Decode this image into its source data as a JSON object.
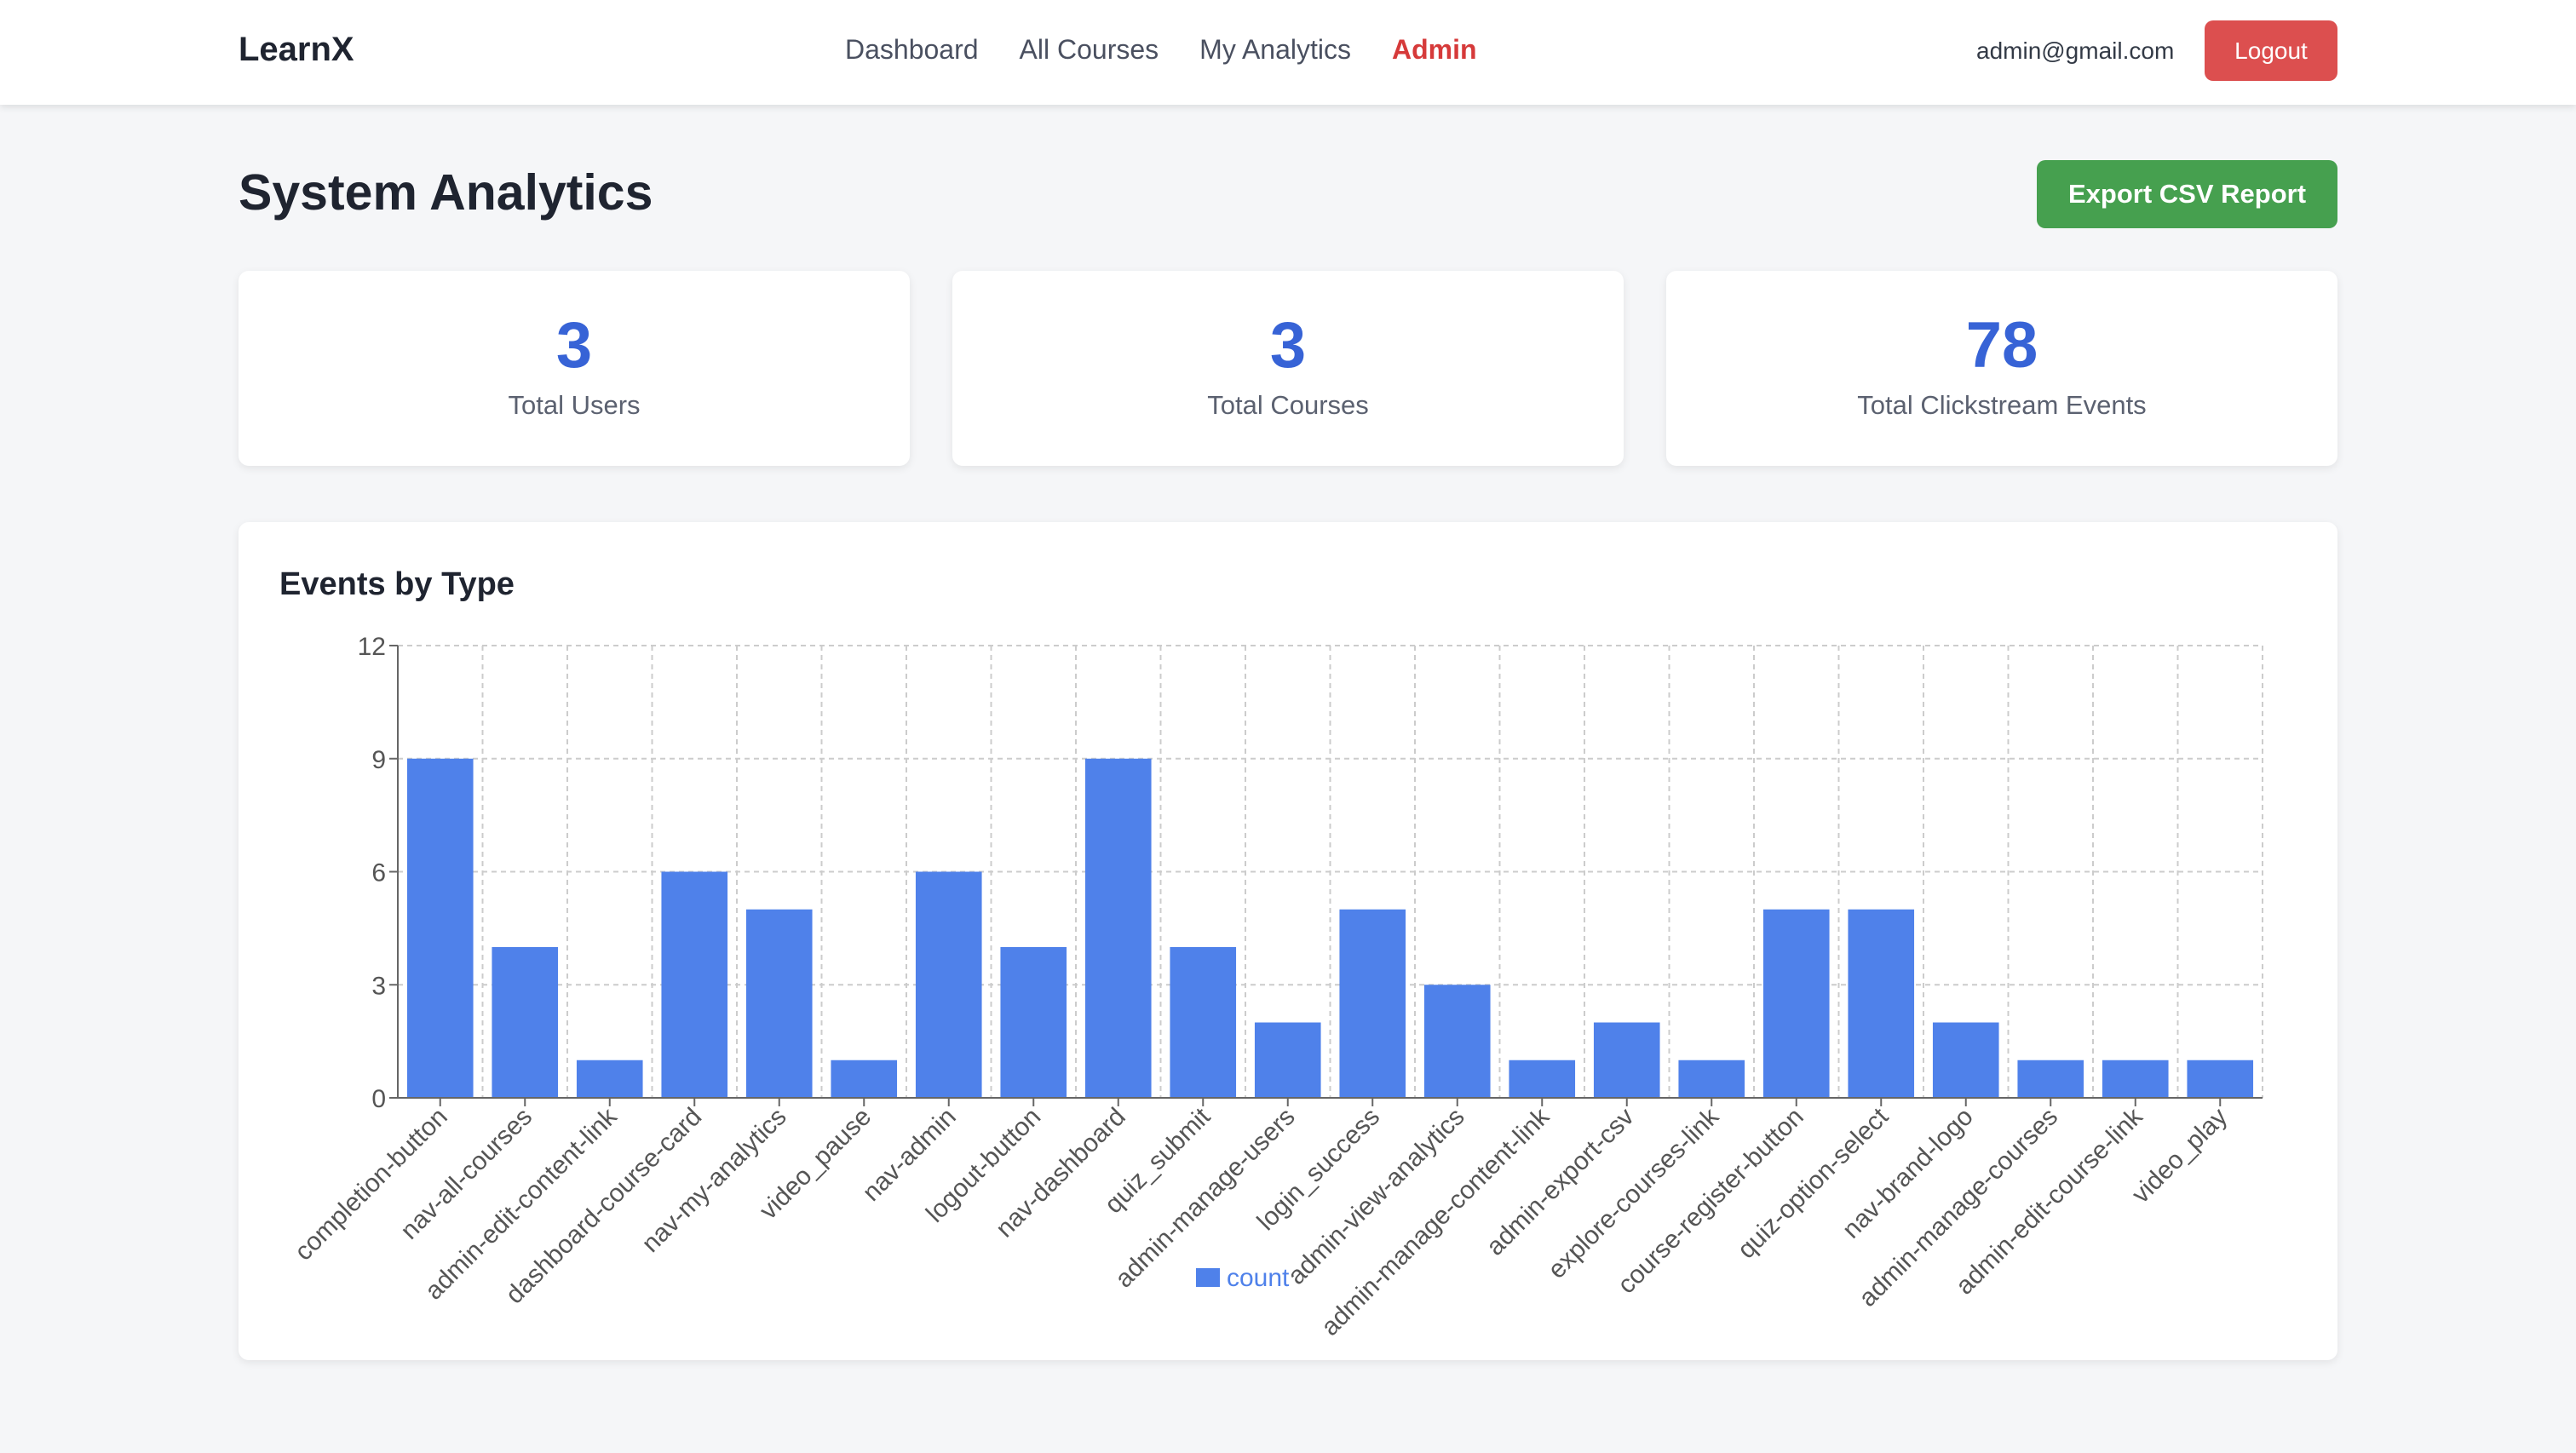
{
  "header": {
    "brand": "LearnX",
    "nav": [
      {
        "label": "Dashboard",
        "active": false
      },
      {
        "label": "All Courses",
        "active": false
      },
      {
        "label": "My Analytics",
        "active": false
      },
      {
        "label": "Admin",
        "active": true
      }
    ],
    "user_email": "admin@gmail.com",
    "logout_label": "Logout"
  },
  "page": {
    "title": "System Analytics",
    "export_label": "Export CSV Report"
  },
  "stats": [
    {
      "value": "3",
      "label": "Total Users"
    },
    {
      "value": "3",
      "label": "Total Courses"
    },
    {
      "value": "78",
      "label": "Total Clickstream Events"
    }
  ],
  "chart_card": {
    "title": "Events by Type"
  },
  "colors": {
    "bar": "#4f81ea",
    "accent": "#3763d6",
    "admin_active": "#d63a3a",
    "logout": "#dc4f4f",
    "export": "#46a04f"
  },
  "chart_data": {
    "type": "bar",
    "title": "Events by Type",
    "xlabel": "",
    "ylabel": "",
    "ylim": [
      0,
      12
    ],
    "yticks": [
      0,
      3,
      6,
      9,
      12
    ],
    "grid": true,
    "legend": "bottom-center",
    "categories": [
      "completion-button",
      "nav-all-courses",
      "admin-edit-content-link",
      "dashboard-course-card",
      "nav-my-analytics",
      "video_pause",
      "nav-admin",
      "logout-button",
      "nav-dashboard",
      "quiz_submit",
      "admin-manage-users",
      "login_success",
      "admin-view-analytics",
      "admin-manage-content-link",
      "admin-export-csv",
      "explore-courses-link",
      "course-register-button",
      "quiz-option-select",
      "nav-brand-logo",
      "admin-manage-courses",
      "admin-edit-course-link",
      "video_play"
    ],
    "series": [
      {
        "name": "count",
        "values": [
          9,
          4,
          1,
          6,
          5,
          1,
          6,
          4,
          9,
          4,
          2,
          5,
          3,
          1,
          2,
          1,
          5,
          5,
          2,
          1,
          1,
          1
        ]
      }
    ]
  }
}
